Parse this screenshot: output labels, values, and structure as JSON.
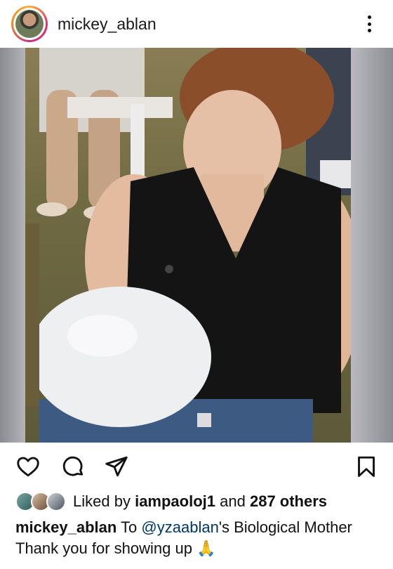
{
  "header": {
    "username": "mickey_ablan"
  },
  "post": {
    "image_alt": "Woman in black sleeveless top holding a white balloon outdoors"
  },
  "actions": {
    "like_icon": "heart-icon",
    "comment_icon": "comment-icon",
    "share_icon": "share-icon",
    "save_icon": "bookmark-icon"
  },
  "likes": {
    "prefix": "Liked by",
    "user": "iampaoloj1",
    "middle": "and",
    "others": "287 others"
  },
  "caption": {
    "user": "mickey_ablan",
    "text_before": "To",
    "mention": "@yzaablan",
    "text_after": "'s Biological Mother Thank you for showing up",
    "emoji": "🙏"
  },
  "colors": {
    "mention": "#00376b",
    "text": "#111111"
  }
}
